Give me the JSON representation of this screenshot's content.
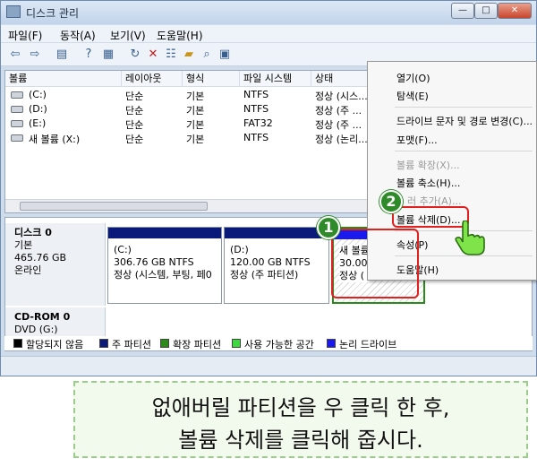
{
  "window": {
    "title": "디스크 관리",
    "min": "—",
    "max": "□",
    "close": "✕"
  },
  "menu": [
    "파일(F)",
    "동작(A)",
    "보기(V)",
    "도움말(H)"
  ],
  "toolbar_icons": [
    "back-arrow-icon",
    "forward-arrow-icon",
    "console-icon",
    "help-icon",
    "view-icon",
    "refresh-icon",
    "delete-icon",
    "properties-icon",
    "open-icon",
    "search-icon",
    "export-icon"
  ],
  "volume_table": {
    "columns": [
      "볼륨",
      "레이아웃",
      "형식",
      "파일 시스템",
      "상태"
    ],
    "rows": [
      [
        "(C:)",
        "단순",
        "기본",
        "NTFS",
        "정상 (시스..."
      ],
      [
        "(D:)",
        "단순",
        "기본",
        "NTFS",
        "정상 (주 ..."
      ],
      [
        "(E:)",
        "단순",
        "기본",
        "FAT32",
        "정상 (주 ..."
      ],
      [
        "새 볼륨 (X:)",
        "단순",
        "기본",
        "NTFS",
        "정상 (논리..."
      ]
    ]
  },
  "disks": [
    {
      "name": "디스크 0",
      "type": "기본",
      "size": "465.76 GB",
      "state": "온라인"
    },
    {
      "name": "CD-ROM 0",
      "type": "DVD (G:)"
    }
  ],
  "partitions": [
    {
      "name": "(C:)",
      "size": "306.76 GB NTFS",
      "status": "정상 (시스템, 부팅, 페0"
    },
    {
      "name": "(D:)",
      "size": "120.00 GB NTFS",
      "status": "정상 (주 파티션)"
    },
    {
      "name": "새 볼륨",
      "size": "30.00",
      "status": "정상 ("
    }
  ],
  "legend": [
    {
      "label": "할당되지 않음",
      "color": "#000000"
    },
    {
      "label": "주 파티션",
      "color": "#0a1a7a"
    },
    {
      "label": "확장 파티션",
      "color": "#2a8a1a"
    },
    {
      "label": "사용 가능한 공간",
      "color": "#3ed93e"
    },
    {
      "label": "논리 드라이브",
      "color": "#1a1aee"
    }
  ],
  "context_menu": {
    "open": "열기(O)",
    "explore": "탐색(E)",
    "change_letter": "드라이브 문자 및 경로 변경(C)...",
    "format": "포맷(F)...",
    "extend": "볼륨 확장(X)...",
    "shrink": "볼륨 축소(H)...",
    "add_mirror": "미러 추가(A)...",
    "mirror_partial": "러 추가(A)...",
    "delete": "볼륨 삭제(D)...",
    "properties": "속성(P)",
    "help": "도움말(H)"
  },
  "steps": [
    "1",
    "2"
  ],
  "caption": [
    "없애버릴 파티션을 우 클릭 한 후,",
    "볼륨 삭제를 클릭해 줍시다."
  ]
}
